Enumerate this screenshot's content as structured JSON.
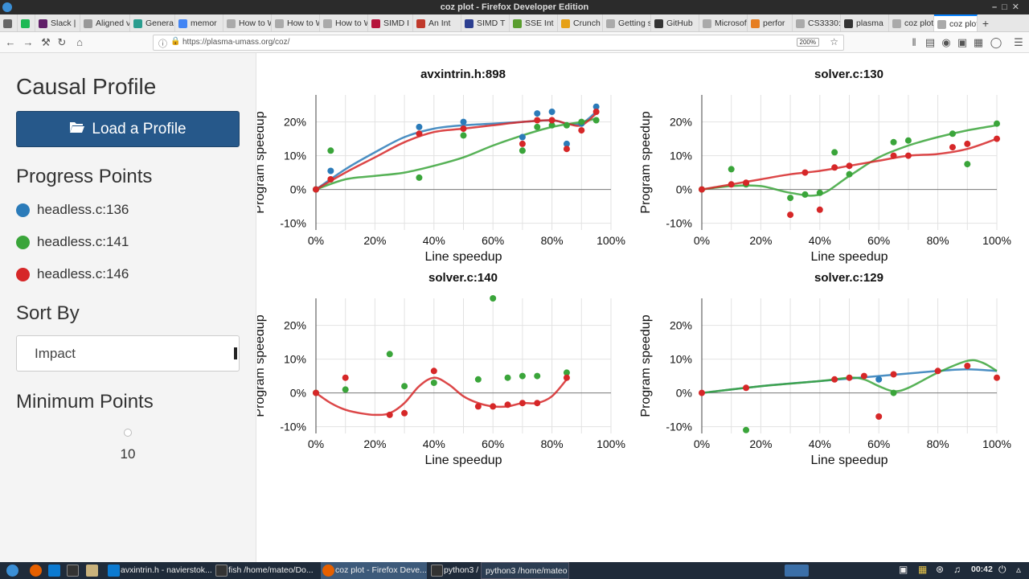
{
  "os": {
    "title": "coz plot - Firefox Developer Edition"
  },
  "tabs": [
    {
      "label": "",
      "color": "#666"
    },
    {
      "label": "",
      "color": "#1db954"
    },
    {
      "label": "Slack |",
      "color": "#611f69"
    },
    {
      "label": "Aligned vs",
      "color": "#999"
    },
    {
      "label": "Genera",
      "color": "#2a9d8f"
    },
    {
      "label": "memor",
      "color": "#4285f4"
    },
    {
      "label": "How to W",
      "color": "#aaa"
    },
    {
      "label": "How to W",
      "color": "#aaa"
    },
    {
      "label": "How to W",
      "color": "#aaa"
    },
    {
      "label": "SIMD I",
      "color": "#b5123a"
    },
    {
      "label": "An Int",
      "color": "#c0392b"
    },
    {
      "label": "SIMD T",
      "color": "#2c3e90"
    },
    {
      "label": "SSE Int",
      "color": "#5a9e2f"
    },
    {
      "label": "Crunch",
      "color": "#e6a117"
    },
    {
      "label": "Getting st",
      "color": "#aaa"
    },
    {
      "label": "GitHub",
      "color": "#333"
    },
    {
      "label": "Microsoft",
      "color": "#aaa"
    },
    {
      "label": "perfor",
      "color": "#e67e22"
    },
    {
      "label": "CS3330: A",
      "color": "#aaa"
    },
    {
      "label": "plasma",
      "color": "#333"
    },
    {
      "label": "coz plot",
      "color": "#aaa"
    },
    {
      "label": "coz plot",
      "color": "#aaa",
      "active": true
    }
  ],
  "navbar": {
    "url": "https://plasma-umass.org/coz/",
    "zoom": "200%"
  },
  "sidebar": {
    "title": "Causal Profile",
    "load_button": "Load a Profile",
    "progress_heading": "Progress Points",
    "legend": [
      {
        "label": "headless.c:136",
        "color": "#2b7bb9"
      },
      {
        "label": "headless.c:141",
        "color": "#3aa53a"
      },
      {
        "label": "headless.c:146",
        "color": "#d62728"
      }
    ],
    "sort_heading": "Sort By",
    "sort_value": "Impact",
    "min_heading": "Minimum Points",
    "min_value": "10"
  },
  "chart_data": [
    {
      "type": "scatter",
      "title": "avxintrin.h:898",
      "xlabel": "Line speedup",
      "ylabel": "Program speedup",
      "xlim": [
        0,
        100
      ],
      "ylim": [
        -12,
        28
      ],
      "xticks": [
        "0%",
        "20%",
        "40%",
        "60%",
        "80%",
        "100%"
      ],
      "yticks": [
        "-10%",
        "0%",
        "10%",
        "20%"
      ],
      "series": [
        {
          "name": "headless.c:136",
          "points": [
            [
              0,
              0
            ],
            [
              5,
              5.5
            ],
            [
              35,
              18.5
            ],
            [
              50,
              20
            ],
            [
              70,
              15.5
            ],
            [
              75,
              22.5
            ],
            [
              80,
              23
            ],
            [
              85,
              13.5
            ],
            [
              90,
              19.5
            ],
            [
              95,
              24.5
            ]
          ],
          "curve": [
            [
              0,
              0
            ],
            [
              10,
              6
            ],
            [
              20,
              11
            ],
            [
              30,
              15.5
            ],
            [
              40,
              18
            ],
            [
              50,
              19
            ],
            [
              60,
              19.5
            ],
            [
              70,
              20
            ],
            [
              80,
              20.5
            ],
            [
              85,
              19.5
            ],
            [
              90,
              19.5
            ],
            [
              95,
              23
            ]
          ]
        },
        {
          "name": "headless.c:141",
          "points": [
            [
              0,
              0
            ],
            [
              5,
              11.5
            ],
            [
              35,
              3.5
            ],
            [
              50,
              16
            ],
            [
              70,
              11.5
            ],
            [
              75,
              18.5
            ],
            [
              80,
              19
            ],
            [
              85,
              19
            ],
            [
              90,
              20
            ],
            [
              95,
              20.5
            ]
          ],
          "curve": [
            [
              0,
              0
            ],
            [
              10,
              3
            ],
            [
              20,
              4
            ],
            [
              30,
              5
            ],
            [
              40,
              7
            ],
            [
              50,
              9.5
            ],
            [
              60,
              13
            ],
            [
              70,
              16
            ],
            [
              80,
              18.5
            ],
            [
              90,
              20
            ],
            [
              95,
              21
            ]
          ]
        },
        {
          "name": "headless.c:146",
          "points": [
            [
              0,
              0
            ],
            [
              5,
              3
            ],
            [
              35,
              16.5
            ],
            [
              50,
              18
            ],
            [
              70,
              13.5
            ],
            [
              75,
              20.5
            ],
            [
              80,
              20.5
            ],
            [
              85,
              12
            ],
            [
              90,
              17.5
            ],
            [
              95,
              23
            ]
          ],
          "curve": [
            [
              0,
              0
            ],
            [
              10,
              5
            ],
            [
              20,
              9.5
            ],
            [
              30,
              14
            ],
            [
              40,
              17
            ],
            [
              50,
              18
            ],
            [
              60,
              19
            ],
            [
              70,
              20
            ],
            [
              80,
              20.5
            ],
            [
              85,
              19.5
            ],
            [
              90,
              19
            ],
            [
              95,
              22.5
            ]
          ]
        }
      ]
    },
    {
      "type": "scatter",
      "title": "solver.c:130",
      "xlabel": "Line speedup",
      "ylabel": "Program speedup",
      "xlim": [
        0,
        100
      ],
      "ylim": [
        -12,
        28
      ],
      "xticks": [
        "0%",
        "20%",
        "40%",
        "60%",
        "80%",
        "100%"
      ],
      "yticks": [
        "-10%",
        "0%",
        "10%",
        "20%"
      ],
      "series": [
        {
          "name": "headless.c:141",
          "points": [
            [
              0,
              0
            ],
            [
              10,
              6
            ],
            [
              15,
              1.5
            ],
            [
              30,
              -2.5
            ],
            [
              35,
              -1.5
            ],
            [
              40,
              -1
            ],
            [
              45,
              11
            ],
            [
              50,
              4.5
            ],
            [
              65,
              14
            ],
            [
              70,
              14.5
            ],
            [
              85,
              16.5
            ],
            [
              90,
              7.5
            ],
            [
              100,
              19.5
            ]
          ],
          "curve": [
            [
              0,
              0
            ],
            [
              10,
              1
            ],
            [
              20,
              1
            ],
            [
              30,
              -1
            ],
            [
              40,
              -1.5
            ],
            [
              50,
              4
            ],
            [
              60,
              9.5
            ],
            [
              70,
              13
            ],
            [
              80,
              15.5
            ],
            [
              90,
              17.5
            ],
            [
              100,
              19
            ]
          ]
        },
        {
          "name": "headless.c:146",
          "points": [
            [
              0,
              0
            ],
            [
              10,
              1.5
            ],
            [
              15,
              2
            ],
            [
              30,
              -7.5
            ],
            [
              35,
              5
            ],
            [
              40,
              -6
            ],
            [
              45,
              6.5
            ],
            [
              50,
              7
            ],
            [
              65,
              10
            ],
            [
              70,
              10
            ],
            [
              85,
              12.5
            ],
            [
              90,
              13.5
            ],
            [
              100,
              15
            ]
          ],
          "curve": [
            [
              0,
              0
            ],
            [
              10,
              1.5
            ],
            [
              20,
              3
            ],
            [
              30,
              4.5
            ],
            [
              40,
              5.5
            ],
            [
              50,
              7
            ],
            [
              60,
              8.5
            ],
            [
              70,
              10
            ],
            [
              80,
              10.5
            ],
            [
              90,
              12
            ],
            [
              100,
              15
            ]
          ]
        }
      ]
    },
    {
      "type": "scatter",
      "title": "solver.c:140",
      "xlabel": "Line speedup",
      "ylabel": "Program speedup",
      "xlim": [
        0,
        100
      ],
      "ylim": [
        -12,
        28
      ],
      "xticks": [
        "0%",
        "20%",
        "40%",
        "60%",
        "80%",
        "100%"
      ],
      "yticks": [
        "-10%",
        "0%",
        "10%",
        "20%"
      ],
      "series": [
        {
          "name": "headless.c:141",
          "points": [
            [
              0,
              0
            ],
            [
              10,
              1
            ],
            [
              25,
              11.5
            ],
            [
              30,
              2
            ],
            [
              40,
              3
            ],
            [
              55,
              4
            ],
            [
              60,
              28
            ],
            [
              65,
              4.5
            ],
            [
              70,
              5
            ],
            [
              75,
              5
            ],
            [
              85,
              6
            ]
          ],
          "curve": []
        },
        {
          "name": "headless.c:146",
          "points": [
            [
              0,
              0
            ],
            [
              10,
              4.5
            ],
            [
              25,
              -6.5
            ],
            [
              30,
              -6
            ],
            [
              40,
              6.5
            ],
            [
              55,
              -4
            ],
            [
              60,
              -4
            ],
            [
              65,
              -3.5
            ],
            [
              70,
              -3
            ],
            [
              75,
              -3
            ],
            [
              85,
              4.5
            ]
          ],
          "curve": [
            [
              0,
              0
            ],
            [
              5,
              -3
            ],
            [
              10,
              -5
            ],
            [
              15,
              -6
            ],
            [
              20,
              -6.5
            ],
            [
              25,
              -6
            ],
            [
              30,
              -3
            ],
            [
              35,
              2
            ],
            [
              40,
              4.5
            ],
            [
              45,
              2.5
            ],
            [
              50,
              -1
            ],
            [
              55,
              -3
            ],
            [
              60,
              -4
            ],
            [
              65,
              -4
            ],
            [
              70,
              -3
            ],
            [
              75,
              -3
            ],
            [
              80,
              -1
            ],
            [
              85,
              4
            ]
          ]
        }
      ]
    },
    {
      "type": "scatter",
      "title": "solver.c:129",
      "xlabel": "Line speedup",
      "ylabel": "Program speedup",
      "xlim": [
        0,
        100
      ],
      "ylim": [
        -12,
        28
      ],
      "xticks": [
        "0%",
        "20%",
        "40%",
        "60%",
        "80%",
        "100%"
      ],
      "yticks": [
        "-10%",
        "0%",
        "10%",
        "20%"
      ],
      "series": [
        {
          "name": "headless.c:136",
          "points": [
            [
              60,
              4
            ]
          ],
          "curve": [
            [
              0,
              0
            ],
            [
              20,
              2
            ],
            [
              40,
              3.5
            ],
            [
              60,
              5
            ],
            [
              80,
              6.5
            ],
            [
              90,
              7
            ],
            [
              100,
              6.5
            ]
          ]
        },
        {
          "name": "headless.c:141",
          "points": [
            [
              15,
              -11
            ],
            [
              65,
              0
            ]
          ],
          "curve": [
            [
              0,
              0
            ],
            [
              20,
              2
            ],
            [
              40,
              3.5
            ],
            [
              50,
              4.5
            ],
            [
              55,
              4
            ],
            [
              60,
              2
            ],
            [
              65,
              0.5
            ],
            [
              70,
              1.5
            ],
            [
              80,
              6
            ],
            [
              90,
              9.5
            ],
            [
              95,
              9
            ],
            [
              100,
              6.5
            ]
          ]
        },
        {
          "name": "headless.c:146",
          "points": [
            [
              0,
              0
            ],
            [
              15,
              1.5
            ],
            [
              45,
              4
            ],
            [
              50,
              4.5
            ],
            [
              55,
              5
            ],
            [
              60,
              -7
            ],
            [
              65,
              5.5
            ],
            [
              80,
              6.5
            ],
            [
              90,
              8
            ],
            [
              100,
              4.5
            ]
          ],
          "curve": []
        }
      ]
    }
  ],
  "colors": {
    "blue": "#2b7bb9",
    "green": "#3aa53a",
    "red": "#d62728"
  },
  "taskbar": {
    "items": [
      "avxintrin.h - navierstok...",
      "fish /home/mateo/Do...",
      "coz plot - Firefox Deve...",
      "python3 /",
      "python3 /home/mateo"
    ],
    "clock": "00:42"
  }
}
